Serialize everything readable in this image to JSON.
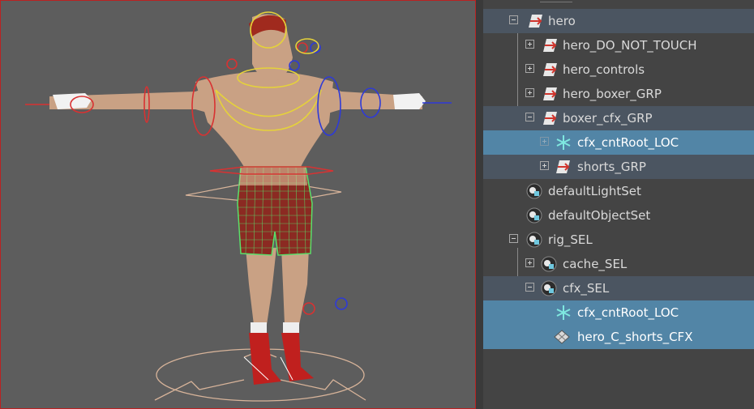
{
  "outliner": {
    "items": [
      {
        "label": "hero",
        "icon": "transform-group-icon",
        "expanded": true,
        "selected": false
      },
      {
        "label": "hero_DO_NOT_TOUCH",
        "icon": "transform-group-icon",
        "expanded": false,
        "selected": false
      },
      {
        "label": "hero_controls",
        "icon": "transform-group-icon",
        "expanded": false,
        "selected": false
      },
      {
        "label": "hero_boxer_GRP",
        "icon": "transform-group-icon",
        "expanded": false,
        "selected": false
      },
      {
        "label": "boxer_cfx_GRP",
        "icon": "transform-group-icon",
        "expanded": true,
        "selected": false
      },
      {
        "label": "cfx_cntRoot_LOC",
        "icon": "locator-icon",
        "expanded": false,
        "selected": true
      },
      {
        "label": "shorts_GRP",
        "icon": "transform-group-icon",
        "expanded": false,
        "selected": false
      },
      {
        "label": "defaultLightSet",
        "icon": "object-set-icon",
        "selected": false
      },
      {
        "label": "defaultObjectSet",
        "icon": "object-set-icon",
        "selected": false
      },
      {
        "label": "rig_SEL",
        "icon": "object-set-icon",
        "expanded": true,
        "selected": false
      },
      {
        "label": "cache_SEL",
        "icon": "object-set-icon",
        "expanded": false,
        "selected": false
      },
      {
        "label": "cfx_SEL",
        "icon": "object-set-icon",
        "expanded": true,
        "selected": false
      },
      {
        "label": "cfx_cntRoot_LOC",
        "icon": "locator-icon",
        "selected": true
      },
      {
        "label": "hero_C_shorts_CFX",
        "icon": "mesh-icon",
        "selected": true
      }
    ]
  },
  "colors": {
    "selection": "#5285a6",
    "highlight": "#4b5561",
    "outliner_bg": "#444444",
    "viewport_bg": "#5d5d5d"
  }
}
